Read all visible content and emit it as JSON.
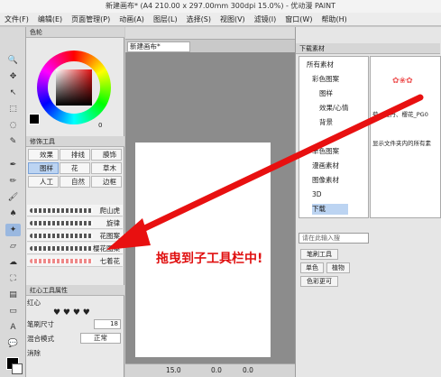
{
  "window": {
    "title": "新建画布* (A4 210.00 x 297.00mm 300dpi 15.0%) - 优动漫 PAINT"
  },
  "menu": [
    "文件(F)",
    "编辑(E)",
    "页面管理(P)",
    "动画(A)",
    "图层(L)",
    "选择(S)",
    "视图(V)",
    "滤镜(I)",
    "窗口(W)",
    "帮助(H)"
  ],
  "color_panel": {
    "tab": "色轮",
    "hue_value": "0"
  },
  "sub_tool_panel": {
    "title": "修饰工具",
    "tabs": [
      "效果",
      "排线",
      "膜饰",
      "图样",
      "花",
      "草木",
      "人工",
      "自然",
      "边框"
    ],
    "decorations": [
      "爬山虎",
      "旋律",
      "花图案",
      "樱花图案",
      "七着花"
    ]
  },
  "property_panel": {
    "title": "红心工具属性",
    "tool_name": "红心",
    "brush_size_label": "笔刷尺寸",
    "brush_size_value": "18",
    "blend_mode_label": "混合模式",
    "blend_mode_value": "正常",
    "erase_label": "消除"
  },
  "canvas": {
    "tab_label": "新建画布*",
    "zoom": "15.0",
    "angle": "0.0",
    "rotation": "0.0"
  },
  "material_panel": {
    "title": "下载素材",
    "tree": [
      "所有素材",
      "彩色图案",
      "图样",
      "效果/心情",
      "背景",
      "",
      "单色图案",
      "漫画素材",
      "图像素材",
      "3D",
      "下载"
    ],
    "preview_caption": "菊、牡丹、樱花_PG0",
    "info_text": "显示文件夹内的所有素",
    "search_placeholder": "请在此输入搜",
    "tags": [
      "笔刷工具",
      "单色",
      "植物",
      "色彩更可"
    ]
  },
  "annotation": {
    "text": "拖曳到子工具栏中!",
    "color": "#e01010"
  }
}
